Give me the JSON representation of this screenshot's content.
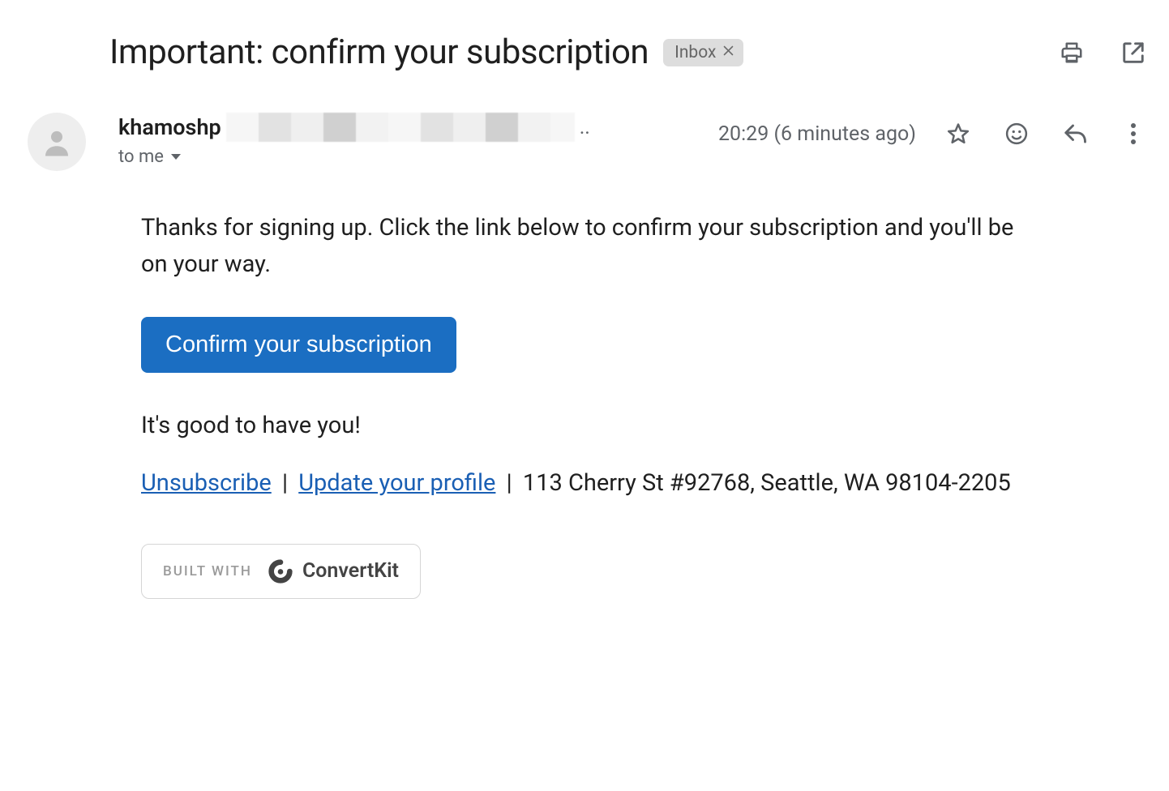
{
  "subject": "Important: confirm your subscription",
  "labels": {
    "inbox": "Inbox"
  },
  "sender": {
    "name_visible": "khamoshp",
    "ellipsis": "..",
    "to": "to me"
  },
  "meta": {
    "timestamp": "20:29 (6 minutes ago)"
  },
  "body": {
    "intro": "Thanks for signing up. Click the link below to confirm your subscription and you'll be on your way.",
    "button_label": "Confirm your subscription",
    "closing": "It's good to have you!"
  },
  "footer": {
    "unsubscribe_label": "Unsubscribe",
    "update_label": "Update your profile",
    "separator": " | ",
    "address": "113 Cherry St #92768, Seattle, WA 98104-2205"
  },
  "provider_badge": {
    "prefix": "BUILT WITH",
    "name": "ConvertKit"
  }
}
